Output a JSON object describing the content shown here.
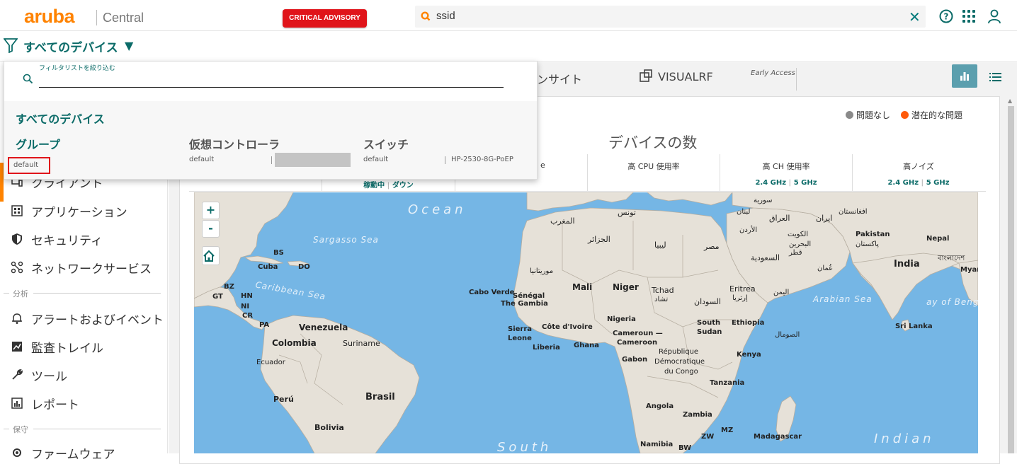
{
  "header": {
    "logo": "aruba",
    "product": "Central",
    "advisory_label": "CRITICAL ADVISORY",
    "search_value": "ssid",
    "clear_icon": "close-icon",
    "icons": [
      "help-icon",
      "apps-grid-icon",
      "user-icon"
    ]
  },
  "filter": {
    "label": "すべてのデバイス"
  },
  "dropdown": {
    "hint": "フィルタリストを絞り込む",
    "all_devices": "すべてのデバイス",
    "groups_title": "グループ",
    "groups_default": "default",
    "vc_title": "仮想コントローラ",
    "vc_default": "default",
    "switch_title": "スイッチ",
    "switch_default": "default",
    "switch_model": "HP-2530-8G-PoEP"
  },
  "sidebar": {
    "items": [
      {
        "label": "クライアント",
        "icon": "client-icon"
      },
      {
        "label": "アプリケーション",
        "icon": "apps-icon"
      },
      {
        "label": "セキュリティ",
        "icon": "shield-icon"
      },
      {
        "label": "ネットワークサービス",
        "icon": "network-services-icon"
      },
      {
        "label": "アラートおよびイベント",
        "icon": "bell-icon"
      },
      {
        "label": "監査トレイル",
        "icon": "audit-icon"
      },
      {
        "label": "ツール",
        "icon": "wrench-icon"
      },
      {
        "label": "レポート",
        "icon": "report-icon"
      },
      {
        "label": "ファームウェア",
        "icon": "firmware-icon"
      }
    ],
    "sections": [
      "分析",
      "保守"
    ]
  },
  "tabs": {
    "insight": "ンサイト",
    "early_access": "Early Access",
    "visualrf": "VISUALRF"
  },
  "panel": {
    "legend_ok": "問題なし",
    "legend_issue": "潜在的な問題",
    "legend_ok_color": "#8a8a8a",
    "legend_issue_color": "#ff5a0a",
    "title": "デバイスの数",
    "status_up": "稼動中",
    "status_down": "ダウン",
    "metric_partial": "e",
    "metrics": [
      {
        "label": "高 CPU 使用率",
        "sub1": "",
        "sub2": ""
      },
      {
        "label": "高 CH 使用率",
        "sub1": "2.4 GHz",
        "sub2": "5 GHz"
      },
      {
        "label": "高ノイズ",
        "sub1": "2.4 GHz",
        "sub2": "5 GHz"
      }
    ]
  },
  "map": {
    "zoom_in": "+",
    "zoom_out": "-",
    "labels": {
      "ocean_n": "Ocean",
      "sargasso": "Sargasso Sea",
      "caribbean": "Caribbean Sea",
      "arabian": "Arabian Sea",
      "bengal": "ay of Bengal",
      "south": "South",
      "indian": "Indian",
      "bs": "BS",
      "cuba": "Cuba",
      "do": "DO",
      "bz": "BZ",
      "gt": "GT",
      "hn": "HN",
      "ni": "NI",
      "cr": "CR",
      "pa": "PA",
      "venezuela": "Venezuela",
      "colombia": "Colombia",
      "suriname": "Suriname",
      "ecuador": "Ecuador",
      "brasil": "Brasil",
      "peru": "Perú",
      "bolivia": "Bolivia",
      "tunis": "تونس",
      "maghreb": "المغرب",
      "algeria": "الجزائر",
      "libya": "ليبيا",
      "egypt": "مصر",
      "mauritania": "موريتانيا",
      "mali": "Mali",
      "niger": "Niger",
      "tchad": "Tchad",
      "tchad_ar": "تشاد",
      "sudan_ar": "السودان",
      "eritrea": "Eritrea",
      "eritrea_ar": "إرتريا",
      "yemen": "اليمن",
      "cabo": "Cabo Verde",
      "senegal": "Sénégal",
      "gambia": "The Gambia",
      "sierra": "Sierra",
      "leone": "Leone",
      "civ": "Côte d'Ivoire",
      "liberia": "Liberia",
      "ghana": "Ghana",
      "nigeria": "Nigeria",
      "cameroun": "Cameroun —",
      "cameroon": "Cameroon",
      "south_sudan1": "South",
      "south_sudan2": "Sudan",
      "ethiopia": "Ethiopia",
      "somalia": "الصومال",
      "kenya": "Kenya",
      "gabon": "Gabon",
      "rdc1": "République",
      "rdc2": "Démocratique",
      "rdc3": "du Congo",
      "tanzania": "Tanzania",
      "angola": "Angola",
      "zambia": "Zambia",
      "zw": "ZW",
      "mz": "MZ",
      "namibia": "Namibia",
      "bw": "BW",
      "madagascar": "Madagascar",
      "syria": "سورية",
      "lebanon": "لبنان",
      "jordan": "الأردن",
      "iraq": "العراق",
      "iran": "ایران",
      "kuwait": "الكويت",
      "bahrain": "البحرين",
      "qatar": "قطر",
      "saudi": "السعودية",
      "oman": "عُمان",
      "afghanistan": "افغانستان",
      "pakistan": "Pakistan",
      "pakistan_ur": "پاکستان",
      "nepal": "Nepal",
      "india": "India",
      "bangladesh": "বাংলাদেশ",
      "myanmar": "Myan",
      "srilanka": "Sri Lanka"
    }
  }
}
